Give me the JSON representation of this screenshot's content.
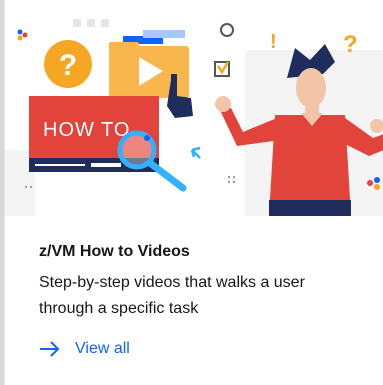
{
  "card": {
    "illustration_icon": "how-to-video-illustration",
    "banner_text": "HOW TO",
    "title": "z/VM How to Videos",
    "description": "Step-by-step videos that walks a user through a specific task",
    "link_label": "View all",
    "link_icon": "arrow-right-icon"
  },
  "colors": {
    "accent": "#0f62fe",
    "banner_red": "#e2433b",
    "question_orange": "#f5a623",
    "folder_orange": "#f8b64c",
    "text": "#161616",
    "card_bg": "#ffffff",
    "page_bg": "#d9d9d9"
  }
}
